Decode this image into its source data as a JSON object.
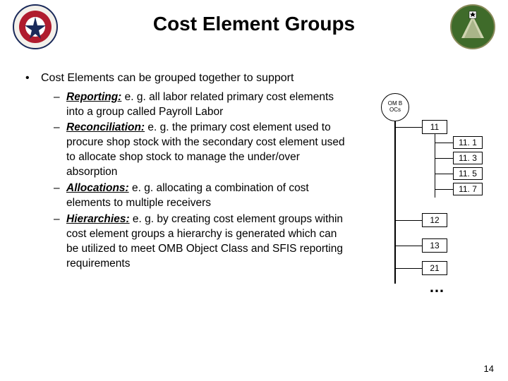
{
  "title": "Cost Element Groups",
  "bullet": {
    "marker": "•",
    "text": "Cost Elements can be grouped together to support"
  },
  "subitems": [
    {
      "lead": "Reporting:",
      "rest": " e. g. all labor related primary cost elements into a group called Payroll Labor"
    },
    {
      "lead": "Reconciliation:",
      "rest": " e. g. the primary cost element used to procure shop stock with the secondary cost element used to allocate shop stock to manage the under/over absorption"
    },
    {
      "lead": "Allocations:",
      "rest": " e. g. allocating a combination of cost elements to multiple receivers"
    },
    {
      "lead": "Hierarchies:",
      "rest": " e. g. by creating cost element groups within cost element groups a hierarchy is generated which can be utilized to meet OMB Object Class and SFIS reporting requirements"
    }
  ],
  "dash": "–",
  "diagram": {
    "root": "OM B OCs",
    "level1": [
      "11",
      "12",
      "13",
      "21"
    ],
    "level2": [
      "11. 1",
      "11. 3",
      "11. 5",
      "11. 7"
    ],
    "dots": "…"
  },
  "page_number": "14",
  "seal_left_alt": "Assistant Secretary of the Army seal",
  "seal_right_alt": "Army cost management seal"
}
